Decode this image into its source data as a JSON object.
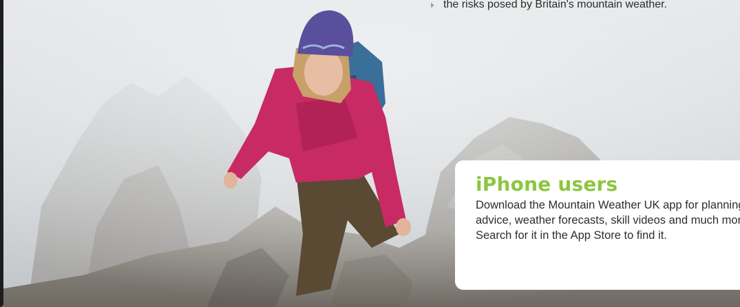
{
  "header": {
    "caption": "the risks posed by Britain's mountain weather."
  },
  "photo": {
    "subject": "hiker-scrambling-on-rocky-ridge"
  },
  "promo": {
    "title": "iPhone users",
    "body": "Download the Mountain Weather UK app for planning advice, weather forecasts, skill videos and much more! Search for it in the App Store to find it.",
    "title_color": "#8cc63f"
  }
}
